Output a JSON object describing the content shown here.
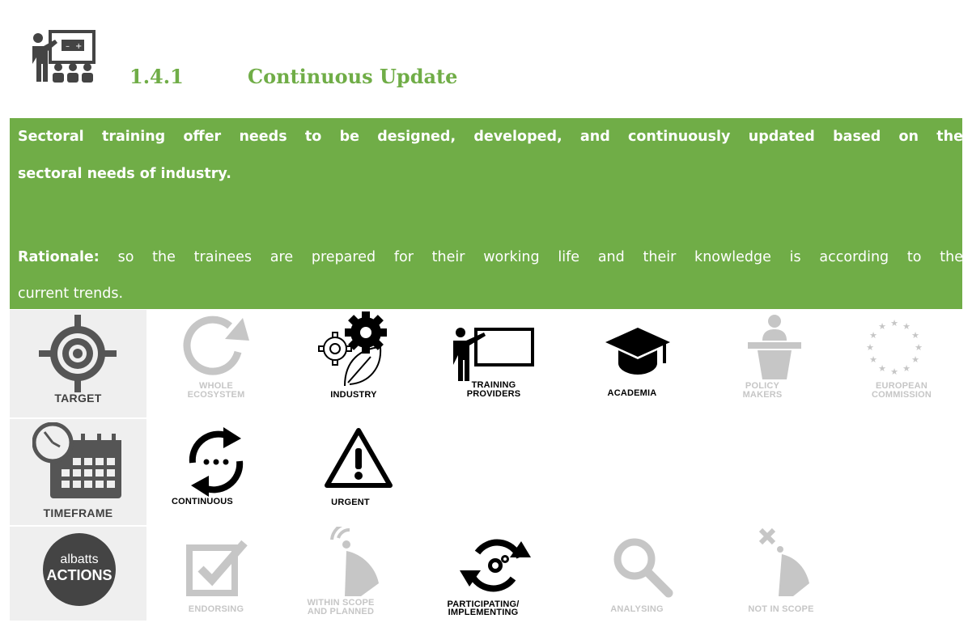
{
  "section": {
    "number": "1.4.1",
    "title": "Continuous Update"
  },
  "statement": {
    "line1": "Sectoral training offer needs to be designed, developed, and continuously updated based on the",
    "line2": "sectoral needs of industry.",
    "rationale_label": "Rationale:",
    "rationale_line1": " so the trainees are prepared for their working life and their knowledge is according to the",
    "rationale_line2": "current trends."
  },
  "rows": {
    "target": {
      "label": "TARGET",
      "items": [
        {
          "label1": "WHOLE",
          "label2": "ECOSYSTEM",
          "active": false
        },
        {
          "label1": "INDUSTRY",
          "label2": "",
          "active": true
        },
        {
          "label1": "TRAINING",
          "label2": "PROVIDERS",
          "active": true
        },
        {
          "label1": "ACADEMIA",
          "label2": "",
          "active": true
        },
        {
          "label1": "POLICY",
          "label2": "MAKERS",
          "active": false
        },
        {
          "label1": "EUROPEAN",
          "label2": "COMMISSION",
          "active": false
        }
      ]
    },
    "timeframe": {
      "label": "TIMEFRAME",
      "items": [
        {
          "label1": "CONTINUOUS",
          "active": true
        },
        {
          "label1": "URGENT",
          "active": true
        }
      ]
    },
    "actions": {
      "logo_top": "albatts",
      "logo_bottom": "ACTIONS",
      "items": [
        {
          "label1": "ENDORSING",
          "label2": "",
          "active": false
        },
        {
          "label1": "WITHIN SCOPE",
          "label2": "AND PLANNED",
          "active": false
        },
        {
          "label1": "PARTICIPATING/",
          "label2": "IMPLEMENTING",
          "active": true
        },
        {
          "label1": "ANALYSING",
          "label2": "",
          "active": false
        },
        {
          "label1": "NOT IN SCOPE",
          "label2": "",
          "active": false
        }
      ]
    }
  },
  "colors": {
    "accent": "#70ad47",
    "active": "#000000",
    "inactive": "#c6c6c6",
    "label_bg": "#efefef"
  }
}
